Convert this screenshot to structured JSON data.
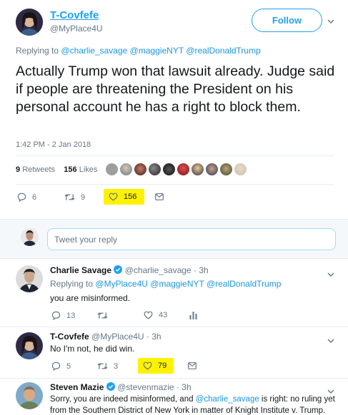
{
  "main_tweet": {
    "name": "T-Covfefe",
    "handle": "@MyPlace4U",
    "follow_label": "Follow",
    "replying_to_label": "Replying to",
    "replying_to": [
      "@charlie_savage",
      "@maggieNYT",
      "@realDonaldTrump"
    ],
    "text": "Actually Trump won that lawsuit already. Judge said if people are threatening the President on his personal account he has a right to block them.",
    "timestamp": "1:42 PM - 2 Jan 2018",
    "retweets_count": "9",
    "retweets_label": "Retweets",
    "likes_count": "156",
    "likes_label": "Likes",
    "actions": {
      "reply": "6",
      "retweet": "9",
      "like": "156"
    }
  },
  "reply_box": {
    "placeholder": "Tweet your reply"
  },
  "replies": [
    {
      "name": "Charlie Savage",
      "handle": "@charlie_savage",
      "time": "· 3h",
      "replying_to_label": "Replying to",
      "replying_to": [
        "@MyPlace4U",
        "@maggieNYT",
        "@realDonaldTrump"
      ],
      "text": "you are misinformed.",
      "reply": "13",
      "retweet": "",
      "like": "43"
    },
    {
      "name": "T-Covfefe",
      "handle": "@MyPlace4U",
      "time": "· 3h",
      "text": "No I'm not, he did win.",
      "reply": "5",
      "retweet": "3",
      "like": "79"
    },
    {
      "name": "Steven Mazie",
      "handle": "@stevenmazie",
      "time": "· 3h",
      "text_before": "Sorry, you are indeed misinformed, and ",
      "mention": "@charlie_savage",
      "text_after": " is right: no ruling yet",
      "text_line2": "from the Southern District of New York in matter of Knight Institute v. Trump."
    }
  ],
  "colors": {
    "accent": "#1da1f2",
    "link": "#1b95e0",
    "muted": "#657786",
    "highlight": "#fff200",
    "like": "#e0245e"
  }
}
